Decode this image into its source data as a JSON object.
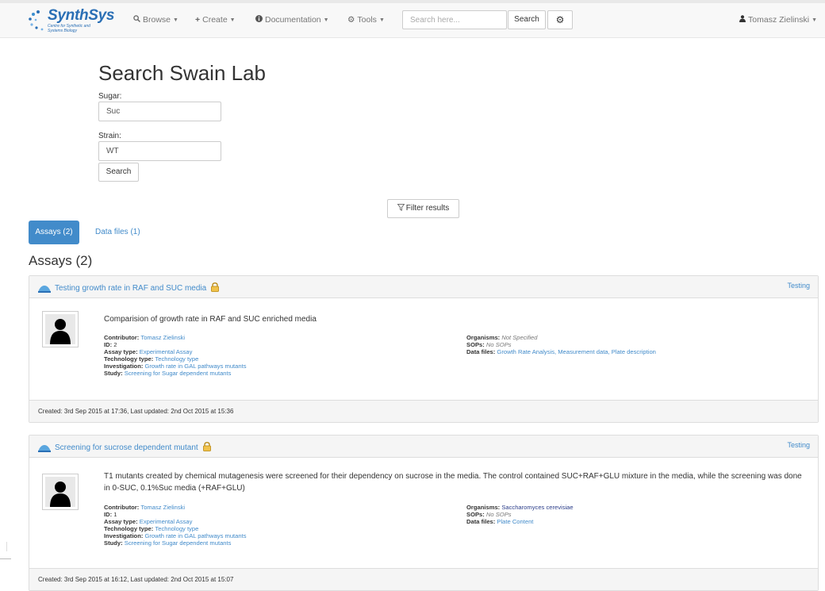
{
  "navbar": {
    "logo": {
      "name": "SynthSys",
      "tagline": "Centre for Synthetic and Systems Biology"
    },
    "menu": [
      {
        "label": "Browse",
        "icon": "search-icon"
      },
      {
        "label": "Create",
        "icon": "plus-icon"
      },
      {
        "label": "Documentation",
        "icon": "info-circle-icon"
      },
      {
        "label": "Tools",
        "icon": "gear-icon"
      }
    ],
    "search": {
      "placeholder": "Search here...",
      "button_label": "Search"
    },
    "settings_icon": "gear-icon",
    "user": {
      "name": "Tomasz Zielinski",
      "icon": "user-icon"
    }
  },
  "search_form": {
    "title": "Search Swain Lab",
    "sugar": {
      "label": "Sugar:",
      "value": "Suc"
    },
    "strain": {
      "label": "Strain:",
      "value": "WT"
    },
    "submit_label": "Search"
  },
  "filter": {
    "label": "Filter results",
    "icon": "filter-icon"
  },
  "tabs": [
    {
      "label": "Assays (2)",
      "active": true
    },
    {
      "label": "Data files (1)",
      "active": false
    }
  ],
  "section_title": "Assays (2)",
  "assays": [
    {
      "title": "Testing growth rate in RAF and SUC media",
      "tag": "Testing",
      "description": "Comparision of growth rate in RAF and SUC enriched media",
      "left_meta": [
        {
          "key": "Contributor",
          "value": "Tomasz Zielinski"
        },
        {
          "key": "ID",
          "value": "2"
        },
        {
          "key": "Assay type",
          "value": "Experimental Assay"
        },
        {
          "key": "Technology type",
          "value": "Technology type"
        },
        {
          "key": "Investigation",
          "value": "Growth rate in GAL pathways mutants"
        },
        {
          "key": "Study",
          "value": "Screening for Sugar dependent mutants"
        }
      ],
      "right_meta": [
        {
          "key": "Organisms",
          "value": "Not Specified"
        },
        {
          "key": "SOPs",
          "value": "No SOPs"
        },
        {
          "key": "Data files",
          "value": "Growth Rate Analysis, Measurement data, Plate description"
        }
      ],
      "footer": "Created: 3rd Sep 2015 at 17:36, Last updated: 2nd Oct 2015 at 15:36"
    },
    {
      "title": "Screening for sucrose dependent mutant",
      "tag": "Testing",
      "description": "T1 mutants created by chemical mutagenesis were screened for their dependency on sucrose in the media. The control contained SUC+RAF+GLU mixture in the media, while the screening was done in 0-SUC, 0.1%Suc media (+RAF+GLU)",
      "left_meta": [
        {
          "key": "Contributor",
          "value": "Tomasz Zielinski"
        },
        {
          "key": "ID",
          "value": "1"
        },
        {
          "key": "Assay type",
          "value": "Experimental Assay"
        },
        {
          "key": "Technology type",
          "value": "Technology type"
        },
        {
          "key": "Investigation",
          "value": "Growth rate in GAL pathways mutants"
        },
        {
          "key": "Study",
          "value": "Screening for Sugar dependent mutants"
        }
      ],
      "right_meta": [
        {
          "key": "Organisms",
          "value": "Saccharomyces cerevisiae"
        },
        {
          "key": "SOPs",
          "value": "No SOPs"
        },
        {
          "key": "Data files",
          "value": "Plate Content"
        }
      ],
      "footer": "Created: 3rd Sep 2015 at 16:12, Last updated: 2nd Oct 2015 at 15:07"
    }
  ],
  "colors": {
    "link": "#428bca",
    "active_tab": "#428bca",
    "navbar_bg": "#f8f8f8",
    "panel_bg": "#f5f5f5"
  }
}
